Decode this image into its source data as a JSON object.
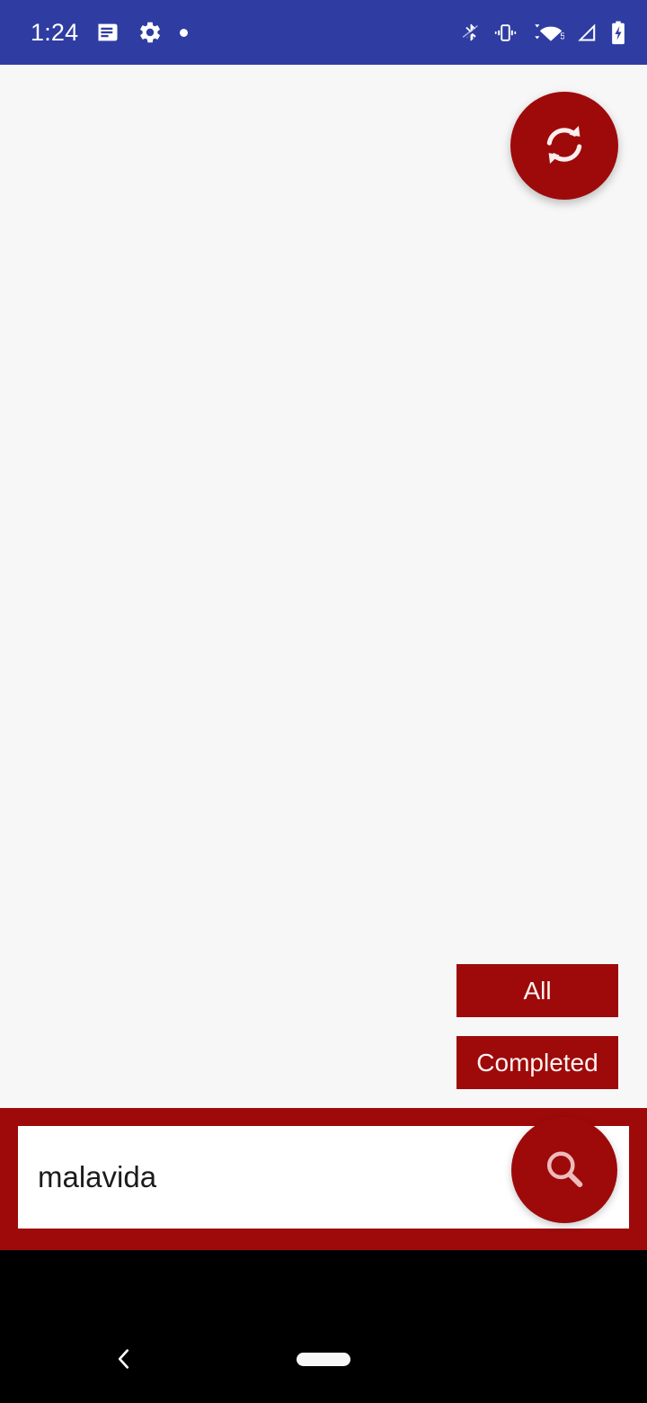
{
  "status_bar": {
    "clock": "1:24",
    "background_color": "#2f3da2",
    "left_icons": [
      {
        "name": "article-icon",
        "label": "notes"
      },
      {
        "name": "gear-icon",
        "label": "settings"
      },
      {
        "name": "dot-icon",
        "label": "notification dot"
      }
    ],
    "right_icons": [
      {
        "name": "bluetooth-disabled-icon",
        "label": "bluetooth off"
      },
      {
        "name": "vibrate-icon",
        "label": "vibrate mode"
      },
      {
        "name": "wifi-icon",
        "label": "wifi",
        "badge": "5"
      },
      {
        "name": "cellular-signal-icon",
        "label": "cellular signal"
      },
      {
        "name": "battery-charging-icon",
        "label": "battery charging"
      }
    ]
  },
  "theme": {
    "accent_red": "#9e0a0a",
    "status_blue": "#2f3da2",
    "page_background": "#f7f7f7",
    "navbar_black": "#000000",
    "button_text": "#fdf3f2"
  },
  "main": {
    "refresh_button_label": "refresh",
    "filters": [
      {
        "id": "all",
        "label": "All"
      },
      {
        "id": "completed",
        "label": "Completed"
      }
    ]
  },
  "search": {
    "value": "malavida",
    "placeholder": "",
    "button_label": "search"
  },
  "navigation": {
    "back_label": "Back",
    "home_label": "Home"
  }
}
